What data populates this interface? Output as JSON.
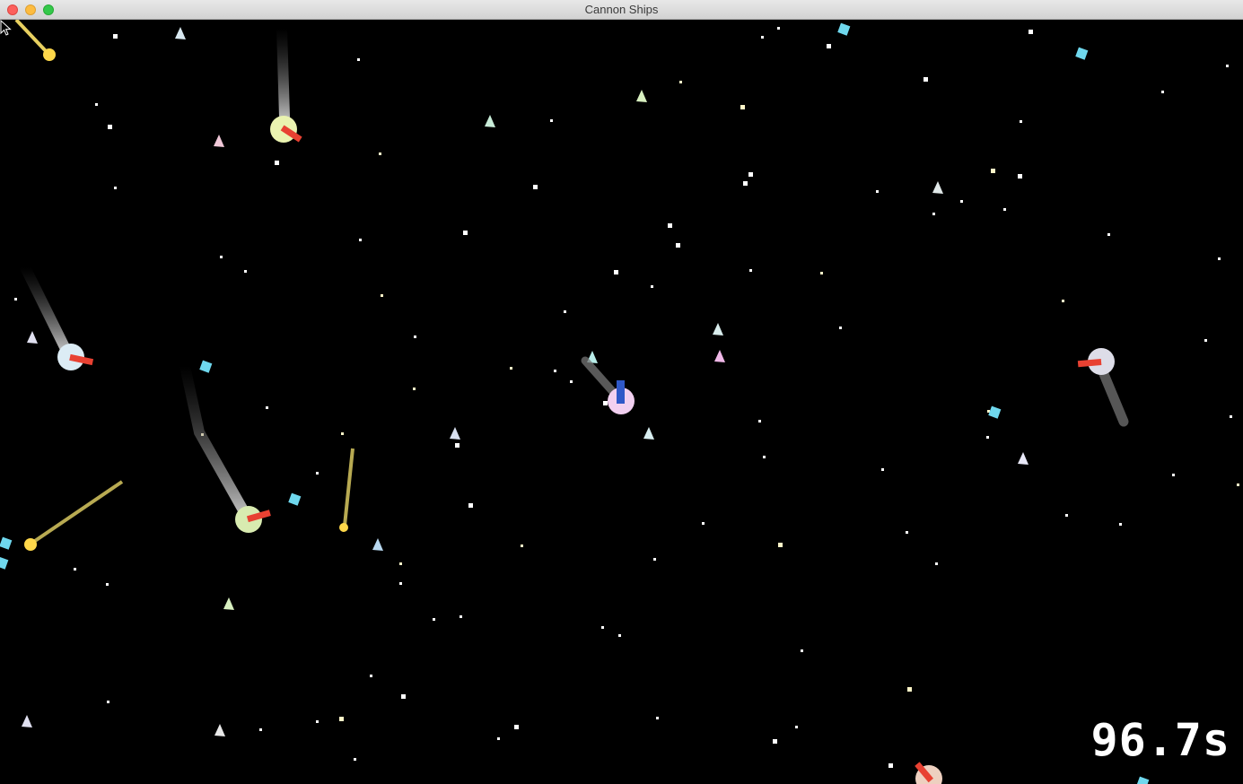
{
  "window": {
    "title": "Cannon Ships",
    "buttons": [
      "close",
      "minimize",
      "maximize"
    ]
  },
  "hud": {
    "timer": "96.7s"
  },
  "colors": {
    "background": "#000000",
    "cannon": "#e84132",
    "player_cannon": "#2f58c8",
    "trail": "#9a9a9a",
    "bullet": "#ffd84a",
    "gem": "#6fd8ee"
  },
  "icons": [
    "player-ship-icon",
    "enemy-ship-icon",
    "cannon-barrel-icon",
    "bullet-icon",
    "gem-pickup-icon",
    "debris-shard-icon",
    "star-icon",
    "mouse-cursor-icon"
  ]
}
